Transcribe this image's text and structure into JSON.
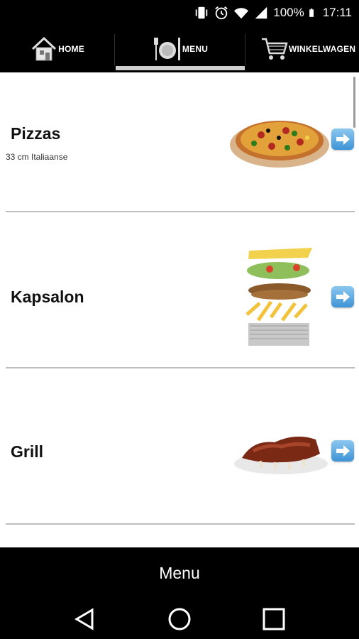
{
  "status_bar": {
    "battery": "100%",
    "time": "17:11",
    "icons": [
      "vibrate-icon",
      "alarm-icon",
      "wifi-icon",
      "signal-icon",
      "battery-icon"
    ]
  },
  "nav": {
    "tabs": [
      {
        "label": "HOME",
        "icon": "home-icon"
      },
      {
        "label": "MENU",
        "icon": "plate-icon"
      },
      {
        "label": "WINKELWAGEN",
        "icon": "cart-icon"
      }
    ],
    "active": "MENU"
  },
  "menu": {
    "items": [
      {
        "title": "Pizzas",
        "subtitle": "33 cm Italiaanse",
        "image": "pizza-image"
      },
      {
        "title": "Kapsalon",
        "subtitle": "",
        "image": "kapsalon-image"
      },
      {
        "title": "Grill",
        "subtitle": "",
        "image": "grill-image"
      }
    ]
  },
  "footer": {
    "title": "Menu"
  },
  "colors": {
    "accent": "#3d94d6",
    "bar": "#000000",
    "divider": "#bdbdbd"
  }
}
